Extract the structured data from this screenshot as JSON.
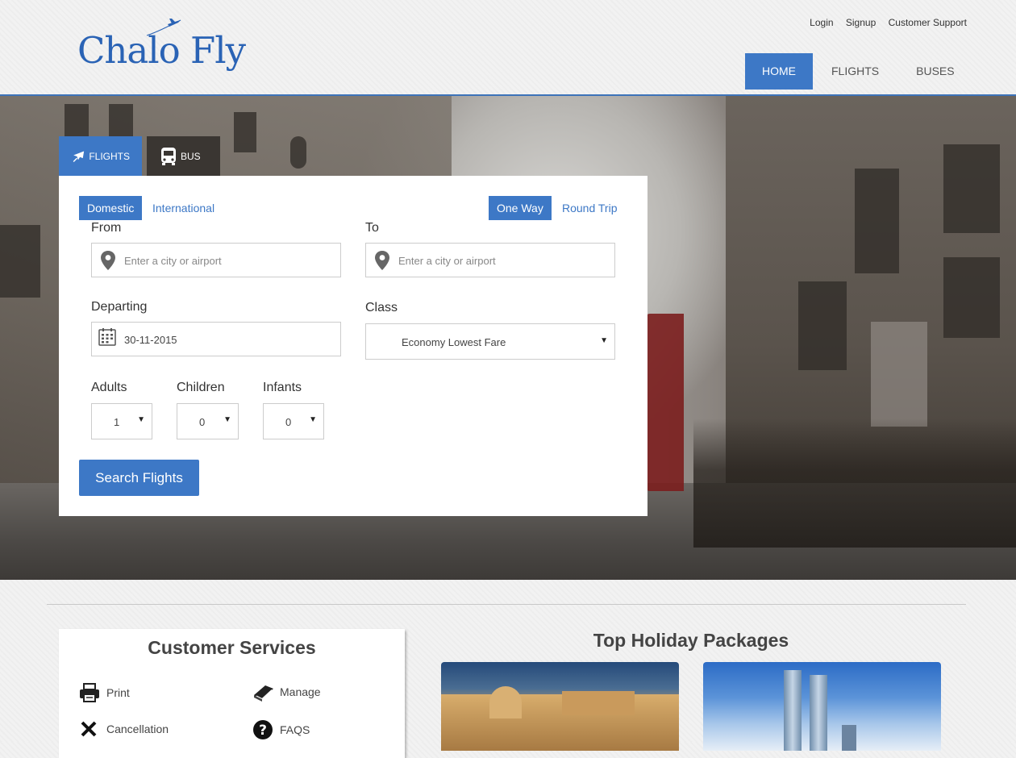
{
  "brand": {
    "name": "Chalo Fly",
    "color": "#2a63b5"
  },
  "top_links": [
    "Login",
    "Signup",
    "Customer Support"
  ],
  "nav": [
    {
      "label": "HOME",
      "active": true
    },
    {
      "label": "FLIGHTS",
      "active": false
    },
    {
      "label": "BUSES",
      "active": false
    }
  ],
  "search_tabs": {
    "flights": "FLIGHTS",
    "bus": "BUS"
  },
  "search": {
    "domestic": "Domestic",
    "international": "International",
    "one_way": "One Way",
    "round_trip": "Round Trip",
    "from_label": "From",
    "from_placeholder": "Enter a city or airport",
    "to_label": "To",
    "to_placeholder": "Enter a city or airport",
    "departing_label": "Departing",
    "departing_value": "30-11-2015",
    "class_label": "Class",
    "class_value": "Economy Lowest Fare",
    "adults_label": "Adults",
    "adults_value": "1",
    "children_label": "Children",
    "children_value": "0",
    "infants_label": "Infants",
    "infants_value": "0",
    "button": "Search Flights"
  },
  "customer_services": {
    "title": "Customer Services",
    "items": [
      "Print",
      "Manage",
      "Cancellation",
      "FAQS"
    ]
  },
  "holiday": {
    "title": "Top Holiday Packages"
  },
  "colors": {
    "accent": "#3d78c6",
    "header_border": "#3d73b9"
  }
}
